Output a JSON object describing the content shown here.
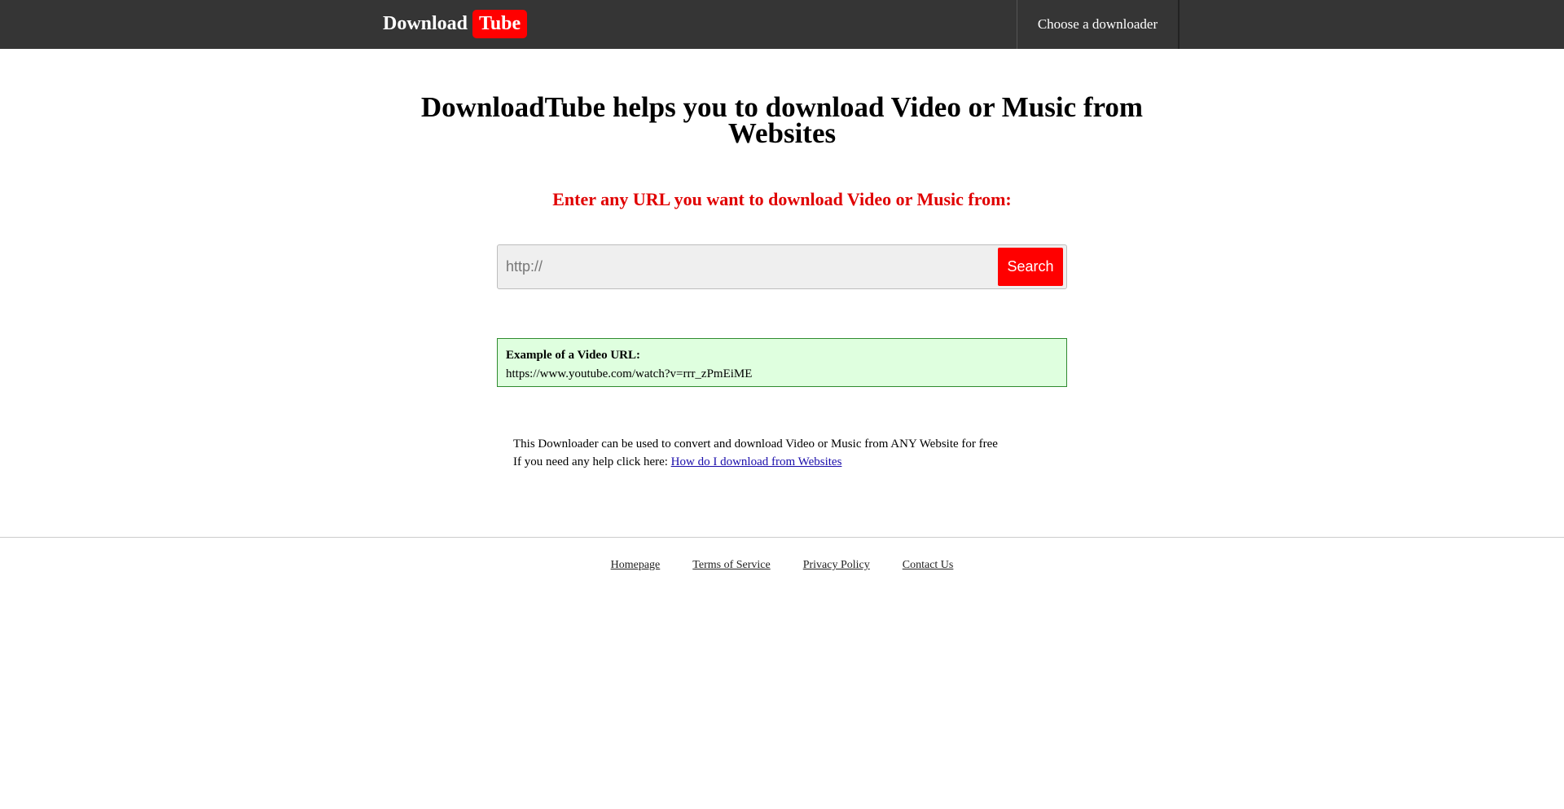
{
  "header": {
    "logo_word1": "Download",
    "logo_word2": "Tube",
    "nav_item": "Choose a downloader"
  },
  "main": {
    "headline": "DownloadTube helps you to download Video or Music from Websites",
    "subhead": "Enter any URL you want to download Video or Music from:",
    "search": {
      "placeholder": "http://",
      "value": "",
      "button_label": "Search"
    },
    "example": {
      "label": "Example of a Video URL:",
      "url": "https://www.youtube.com/watch?v=rrr_zPmEiME"
    },
    "info": {
      "line1": "This Downloader can be used to convert and download Video or Music from ANY Website for free",
      "line2_prefix": "If you need any help click here: ",
      "help_link": "How do I download from Websites"
    }
  },
  "footer": {
    "links": [
      "Homepage",
      "Terms of Service",
      "Privacy Policy",
      "Contact Us"
    ]
  },
  "colors": {
    "topbar": "#353535",
    "accent_red": "#ff0000",
    "subhead_red": "#e00000",
    "example_bg": "#dfffdf",
    "example_border": "#2e8b2e"
  }
}
